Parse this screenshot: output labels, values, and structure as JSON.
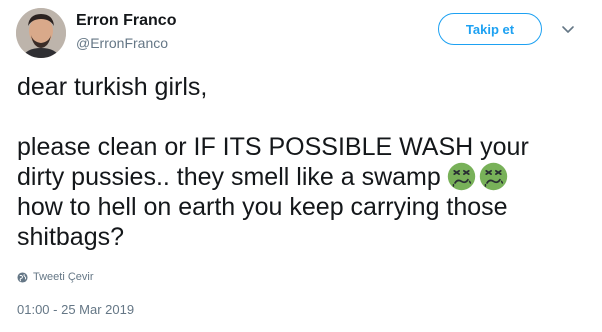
{
  "author": {
    "display_name": "Erron Franco",
    "handle": "@ErronFranco"
  },
  "actions": {
    "follow_label": "Takip et"
  },
  "tweet": {
    "lines": [
      "dear turkish girls,",
      "",
      "please clean or IF ITS POSSIBLE WASH your",
      "dirty pussies.. they smell like a swamp",
      "how to hell on earth you keep carrying those",
      "shitbags?"
    ],
    "emojis_after_line_4": [
      "nauseated-face-emoji",
      "nauseated-face-emoji"
    ],
    "translate_label": "Tweeti Çevir",
    "timestamp": "01:00 - 25 Mar 2019"
  },
  "colors": {
    "accent": "#1da1f2",
    "text": "#14171a",
    "secondary": "#657786",
    "emoji_green": "#78b159"
  }
}
